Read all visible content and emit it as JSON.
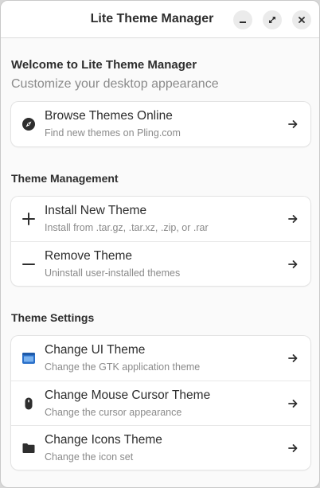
{
  "window": {
    "title": "Lite Theme Manager"
  },
  "welcome": {
    "title": "Welcome to Lite Theme Manager",
    "subtitle": "Customize your desktop appearance"
  },
  "browse": {
    "title": "Browse Themes Online",
    "subtitle": "Find new themes on Pling.com",
    "icon": "compass-icon"
  },
  "management": {
    "heading": "Theme Management",
    "items": [
      {
        "title": "Install New Theme",
        "subtitle": "Install from .tar.gz, .tar.xz, .zip, or .rar",
        "icon": "plus-icon"
      },
      {
        "title": "Remove Theme",
        "subtitle": "Uninstall user-installed themes",
        "icon": "minus-icon"
      }
    ]
  },
  "settings": {
    "heading": "Theme Settings",
    "items": [
      {
        "title": "Change UI Theme",
        "subtitle": "Change the GTK application theme",
        "icon": "window-icon"
      },
      {
        "title": "Change Mouse Cursor Theme",
        "subtitle": "Change the cursor appearance",
        "icon": "mouse-icon"
      },
      {
        "title": "Change Icons Theme",
        "subtitle": "Change the icon set",
        "icon": "folder-icon"
      }
    ]
  },
  "colors": {
    "accent": "#3584e4",
    "text": "#2e2e2e",
    "muted": "#8a8a8a"
  }
}
